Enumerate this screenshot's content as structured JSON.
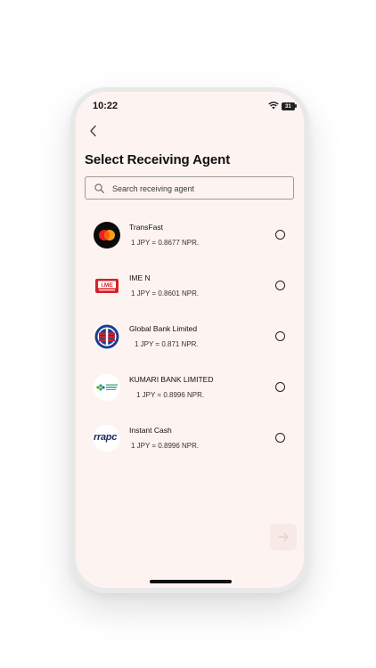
{
  "status_bar": {
    "time": "10:22",
    "battery": "31"
  },
  "header": {
    "title": "Select Receiving Agent"
  },
  "search": {
    "placeholder": "Search receiving agent"
  },
  "agents": [
    {
      "name": "TransFast",
      "rate": "1 JPY = 0.8677 NPR.",
      "logo": "mastercard-logo"
    },
    {
      "name": "IME N",
      "rate": "1 JPY = 0.8601 NPR.",
      "logo": "ime-logo"
    },
    {
      "name": "Global Bank Limited",
      "rate": "1 JPY = 0.871 NPR.",
      "logo": "global-bank-logo"
    },
    {
      "name": "KUMARI BANK LIMITED",
      "rate": "1 JPY = 0.8996 NPR.",
      "logo": "kumari-bank-logo"
    },
    {
      "name": "Instant Cash",
      "rate": "1 JPY = 0.8996 NPR.",
      "logo": "instant-cash-logo",
      "logo_text": "rrapc"
    }
  ],
  "colors": {
    "background": "#fdf4f2",
    "next_button": "#f6e9e6",
    "text": "#111111"
  }
}
